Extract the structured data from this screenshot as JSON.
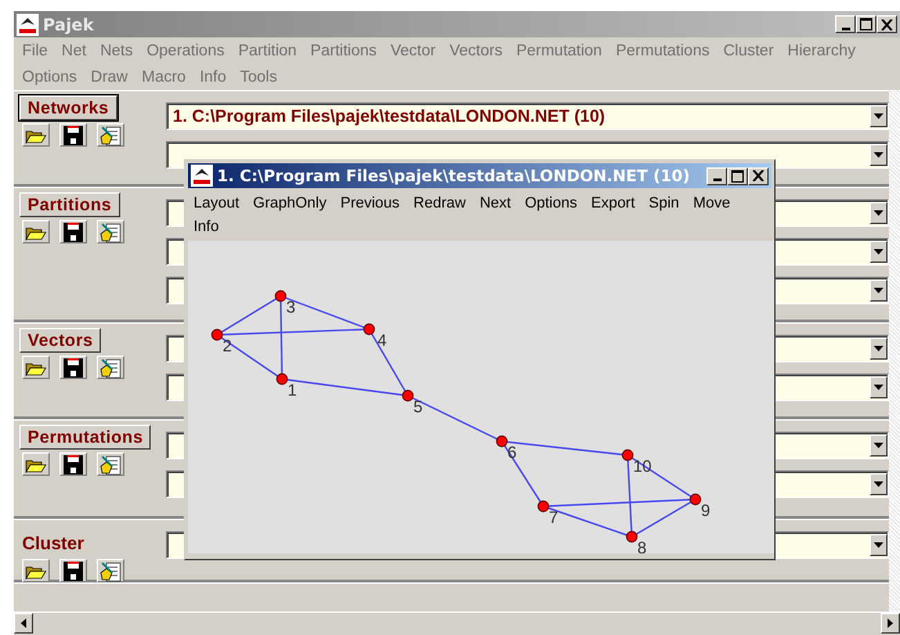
{
  "window": {
    "title": "Pajek"
  },
  "menu_rows": [
    [
      "File",
      "Net",
      "Nets",
      "Operations",
      "Partition",
      "Partitions",
      "Vector",
      "Vectors",
      "Permutation",
      "Permutations",
      "Cluster",
      "Hierarchy"
    ],
    [
      "Options",
      "Draw",
      "Macro",
      "Info",
      "Tools"
    ]
  ],
  "sections": [
    {
      "title": "Networks",
      "kind": "button",
      "selected": true,
      "fields": [
        {
          "kind": "dropdown",
          "value": "1. C:\\Program Files\\pajek\\testdata\\LONDON.NET (10)"
        },
        {
          "kind": "dropdown"
        }
      ]
    },
    {
      "title": "Partitions",
      "kind": "button",
      "selected": false,
      "fields": [
        {
          "kind": "dropdown"
        },
        {
          "kind": "dropdown"
        },
        {
          "kind": "dropdown"
        }
      ]
    },
    {
      "title": "Vectors",
      "kind": "button",
      "selected": false,
      "fields": [
        {
          "kind": "dropdown"
        },
        {
          "kind": "dropdown"
        }
      ]
    },
    {
      "title": "Permutations",
      "kind": "button",
      "selected": false,
      "fields": [
        {
          "kind": "dropdown"
        },
        {
          "kind": "dropdown"
        }
      ]
    },
    {
      "title": "Cluster",
      "kind": "label",
      "selected": false,
      "fields": [
        {
          "kind": "dropdown"
        }
      ]
    }
  ],
  "draw_window": {
    "title": "1. C:\\Program Files\\pajek\\testdata\\LONDON.NET (10)",
    "menu_rows": [
      [
        "Layout",
        "GraphOnly",
        "Previous",
        "Redraw",
        "Next",
        "Options",
        "Export",
        "Spin",
        "Move"
      ],
      [
        "Info"
      ]
    ],
    "nodes": [
      {
        "label": "1"
      },
      {
        "label": "2"
      },
      {
        "label": "3"
      },
      {
        "label": "4"
      },
      {
        "label": "5"
      },
      {
        "label": "6"
      },
      {
        "label": "7"
      },
      {
        "label": "8"
      },
      {
        "label": "9"
      },
      {
        "label": "10"
      }
    ]
  }
}
